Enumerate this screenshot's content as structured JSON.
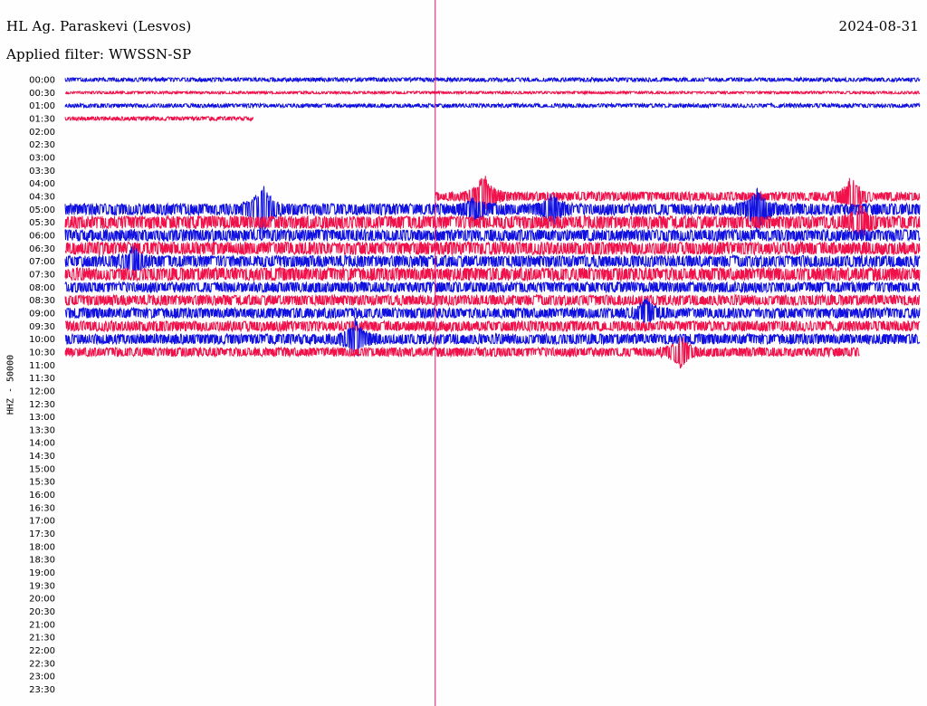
{
  "header": {
    "station": "HL Ag. Paraskevi (Lesvos)",
    "date": "2024-08-31",
    "filter": "Applied filter: WWSSN-SP"
  },
  "chart_data": {
    "type": "line",
    "title": "HL Ag. Paraskevi (Lesvos)",
    "ylabel": "HHZ - 50000",
    "xlabel": "",
    "row_labels": [
      "00:00",
      "00:30",
      "01:00",
      "01:30",
      "02:00",
      "02:30",
      "03:00",
      "03:30",
      "04:00",
      "04:30",
      "05:00",
      "05:30",
      "06:00",
      "06:30",
      "07:00",
      "07:30",
      "08:00",
      "08:30",
      "09:00",
      "09:30",
      "10:00",
      "10:30",
      "11:00",
      "11:30",
      "12:00",
      "12:30",
      "13:00",
      "13:30",
      "14:00",
      "14:30",
      "15:00",
      "15:30",
      "16:00",
      "16:30",
      "17:00",
      "17:30",
      "18:00",
      "18:30",
      "19:00",
      "19:30",
      "20:00",
      "20:30",
      "21:00",
      "21:30",
      "22:00",
      "22:30",
      "23:00",
      "23:30"
    ],
    "colors": {
      "even": "#1010e0",
      "odd": "#f0104a",
      "marker": "#e0106a"
    },
    "marker_fraction": 0.433,
    "traces": [
      {
        "row": 0,
        "start": 0.0,
        "end": 1.0,
        "amp": 1.5
      },
      {
        "row": 1,
        "start": 0.0,
        "end": 1.0,
        "amp": 1.0
      },
      {
        "row": 2,
        "start": 0.0,
        "end": 1.0,
        "amp": 1.5
      },
      {
        "row": 3,
        "start": 0.0,
        "end": 0.22,
        "amp": 1.5
      },
      {
        "row": 9,
        "start": 0.433,
        "end": 1.0,
        "amp": 3.5
      },
      {
        "row": 10,
        "start": 0.0,
        "end": 1.0,
        "amp": 4.5
      },
      {
        "row": 11,
        "start": 0.0,
        "end": 1.0,
        "amp": 5.0
      },
      {
        "row": 12,
        "start": 0.0,
        "end": 1.0,
        "amp": 4.5
      },
      {
        "row": 13,
        "start": 0.0,
        "end": 1.0,
        "amp": 5.0
      },
      {
        "row": 14,
        "start": 0.0,
        "end": 1.0,
        "amp": 4.5
      },
      {
        "row": 15,
        "start": 0.0,
        "end": 1.0,
        "amp": 5.0
      },
      {
        "row": 16,
        "start": 0.0,
        "end": 1.0,
        "amp": 4.0
      },
      {
        "row": 17,
        "start": 0.0,
        "end": 1.0,
        "amp": 4.0
      },
      {
        "row": 18,
        "start": 0.0,
        "end": 1.0,
        "amp": 4.0
      },
      {
        "row": 19,
        "start": 0.0,
        "end": 1.0,
        "amp": 4.0
      },
      {
        "row": 20,
        "start": 0.0,
        "end": 1.0,
        "amp": 4.0
      },
      {
        "row": 21,
        "start": 0.0,
        "end": 0.93,
        "amp": 3.5
      }
    ],
    "events": [
      {
        "row": 10,
        "pos": 0.23,
        "amp": 30
      },
      {
        "row": 10,
        "pos": 0.48,
        "amp": 12
      },
      {
        "row": 9,
        "pos": 0.49,
        "amp": 25
      },
      {
        "row": 10,
        "pos": 0.57,
        "amp": 16
      },
      {
        "row": 10,
        "pos": 0.81,
        "amp": 24
      },
      {
        "row": 9,
        "pos": 0.92,
        "amp": 22
      },
      {
        "row": 11,
        "pos": 0.93,
        "amp": 18
      },
      {
        "row": 20,
        "pos": 0.34,
        "amp": 20
      },
      {
        "row": 21,
        "pos": 0.72,
        "amp": 18
      },
      {
        "row": 18,
        "pos": 0.68,
        "amp": 14
      },
      {
        "row": 14,
        "pos": 0.08,
        "amp": 14
      }
    ]
  }
}
